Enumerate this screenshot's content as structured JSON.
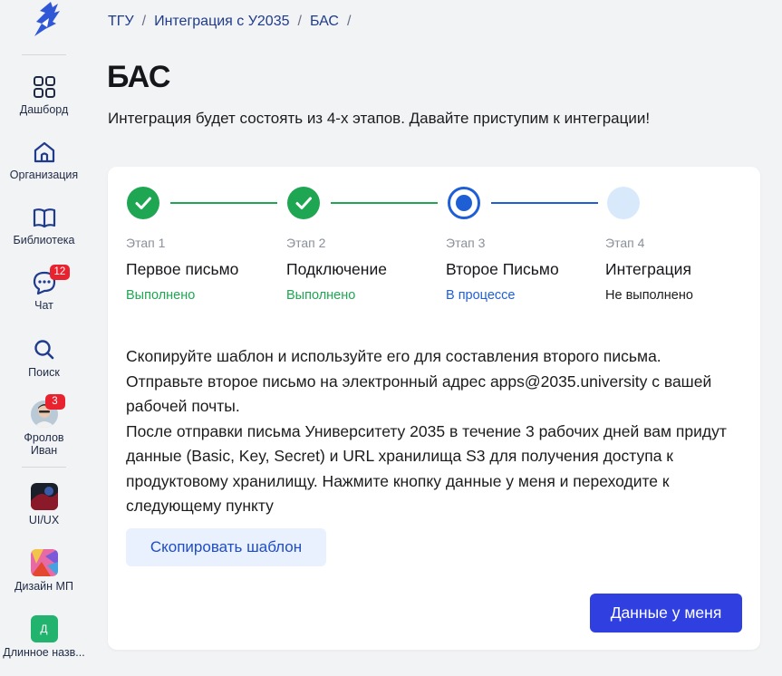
{
  "sidebar": {
    "items": [
      {
        "id": "dashboard",
        "label": "Дашборд",
        "icon": "dashboard-grid-icon"
      },
      {
        "id": "organization",
        "label": "Организация",
        "icon": "organization-home-icon"
      },
      {
        "id": "library",
        "label": "Библиотека",
        "icon": "book-icon"
      },
      {
        "id": "chat",
        "label": "Чат",
        "icon": "chat-bubble-icon",
        "badge": "12"
      },
      {
        "id": "search",
        "label": "Поиск",
        "icon": "search-icon"
      },
      {
        "id": "profile",
        "label": "Фролов Иван",
        "badge": "3"
      }
    ],
    "projects": [
      {
        "label": "UI/UX"
      },
      {
        "label": "Дизайн МП"
      },
      {
        "label": "Длинное назв...",
        "letter": "Д"
      }
    ]
  },
  "breadcrumb": {
    "items": [
      "ТГУ",
      "Интеграция с У2035",
      "БАС"
    ],
    "separator": "/"
  },
  "page": {
    "title": "БАС",
    "subtitle": "Интеграция будет состоять из 4-х этапов. Давайте приступим к интеграции!"
  },
  "steps": [
    {
      "number": "Этап 1",
      "name": "Первое письмо",
      "status": "Выполнено",
      "state": "done"
    },
    {
      "number": "Этап 2",
      "name": "Подключение",
      "status": "Выполнено",
      "state": "done"
    },
    {
      "number": "Этап 3",
      "name": "Второе Письмо",
      "status": "В процессе",
      "state": "active"
    },
    {
      "number": "Этап 4",
      "name": "Интеграция",
      "status": "Не выполнено",
      "state": "pending"
    }
  ],
  "instructions": {
    "line1": "Скопируйте шаблон и используйте его для составления второго письма.",
    "line2": "Отправьте второе письмо на электронный адрес apps@2035.university с вашей рабочей почты.",
    "line3": "После отправки письма Университету 2035 в течение 3 рабочих дней вам придут данные (Basic, Key, Secret) и URL хранилища S3 для получения доступа к продуктовому хранилищу. Нажмите кнопку данные у меня и переходите к следующему пункту"
  },
  "actions": {
    "copy_template": "Скопировать шаблон",
    "have_data": "Данные у меня"
  },
  "colors": {
    "done": "#1fa652",
    "active": "#1f5fd6",
    "pending": "#d7e9fb",
    "primary": "#2f3fe0"
  }
}
